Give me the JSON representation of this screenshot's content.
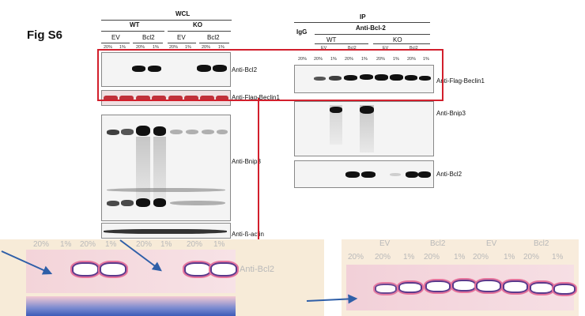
{
  "figure": {
    "title": "Fig S6"
  },
  "wcl": {
    "header": "WCL",
    "groups": [
      "WT",
      "KO"
    ],
    "subgroups": [
      "EV",
      "Bcl2",
      "EV",
      "Bcl2"
    ],
    "lanes": [
      "20%",
      "1%",
      "20%",
      "1%",
      "20%",
      "1%",
      "20%",
      "1%"
    ],
    "labels": {
      "bcl2": "Anti-Bcl2",
      "flag": "Anti-Flag-Beclin1",
      "bnip3": "Anti-Bnip3",
      "actin": "Anti-ß-actin"
    }
  },
  "ip": {
    "header": "IP",
    "igg": "IgG",
    "antibody": "Anti-Bcl-2",
    "groups": [
      "WT",
      "KO"
    ],
    "subgroups": [
      "EV",
      "Bcl2",
      "EV",
      "Bcl2"
    ],
    "lanes": [
      "20%",
      "20%",
      "1%",
      "20%",
      "1%",
      "20%",
      "1%",
      "20%",
      "1%"
    ],
    "labels": {
      "flag": "Anti-Flag-Beclin1",
      "bnip3": "Anti-Bnip3",
      "bcl2": "Anti-Bcl2"
    }
  },
  "zoom_left": {
    "lanes": [
      "20%",
      "1%",
      "20%",
      "1%",
      "20%",
      "1%",
      "20%",
      "1%"
    ],
    "label": "Anti-Bcl2"
  },
  "zoom_right": {
    "groups": [
      "EV",
      "Bcl2",
      "EV",
      "Bcl2"
    ],
    "lanes": [
      "20%",
      "20%",
      "1%",
      "20%",
      "1%",
      "20%",
      "1%",
      "20%",
      "1%"
    ]
  },
  "colors": {
    "highlight": "#d21f2c",
    "arrow": "#2f5fa8"
  }
}
